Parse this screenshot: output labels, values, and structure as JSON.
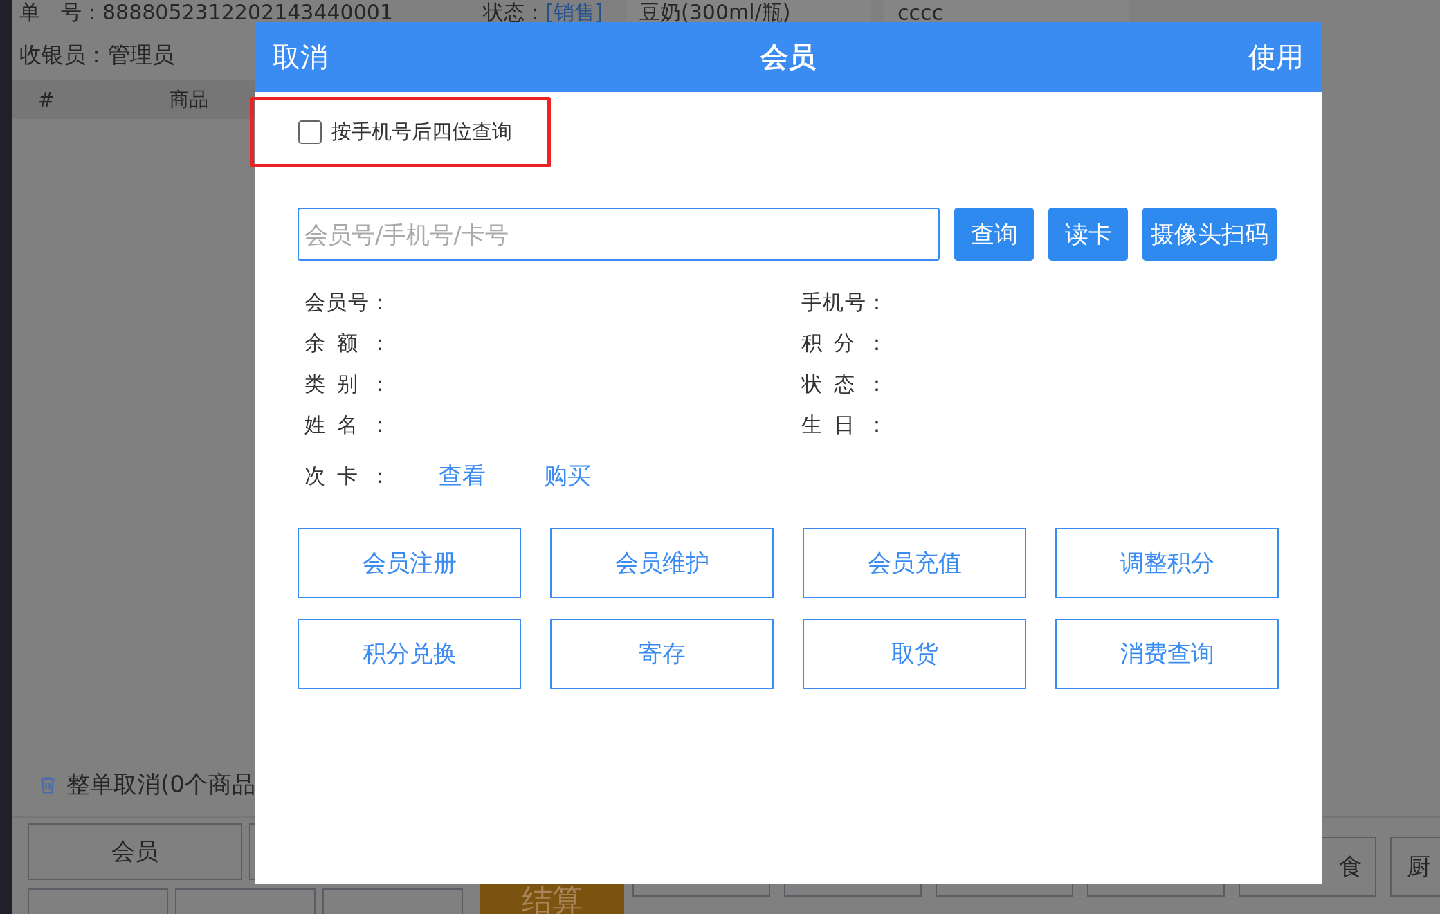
{
  "background": {
    "order": "单　号：8888052312202143440001",
    "status_label": "状态：",
    "status": "[销售]",
    "product_cell": "豆奶(300ml/瓶)",
    "column_cell": "cccc",
    "cashier": "收银员：管理员",
    "table_columns": [
      "#",
      "商品"
    ],
    "cancel_order": "整单取消(0个商品",
    "member_button": "会员",
    "settle": "结算",
    "right_buttons": [
      "食",
      "厨"
    ]
  },
  "dialog": {
    "title": "会员",
    "cancel": "取消",
    "use": "使用",
    "last_four": {
      "label": "按手机号后四位查询",
      "checked": false,
      "highlighted": true
    },
    "search": {
      "placeholder": "会员号/手机号/卡号"
    },
    "actions": [
      "查询",
      "读卡",
      "摄像头扫码"
    ],
    "fields": [
      {
        "label": "会员号：",
        "label2": "手机号："
      },
      {
        "label": "余额：",
        "label2": "积分："
      },
      {
        "label": "类别：",
        "label2": "状态："
      },
      {
        "label": "姓名：",
        "label2": "生日："
      }
    ],
    "punch_card": {
      "label": "次卡：",
      "links": [
        "查看",
        "购买"
      ]
    },
    "buttons": [
      "会员注册",
      "会员维护",
      "会员充值",
      "调整积分",
      "积分兑换",
      "寄存",
      "取货",
      "消费查询"
    ]
  }
}
